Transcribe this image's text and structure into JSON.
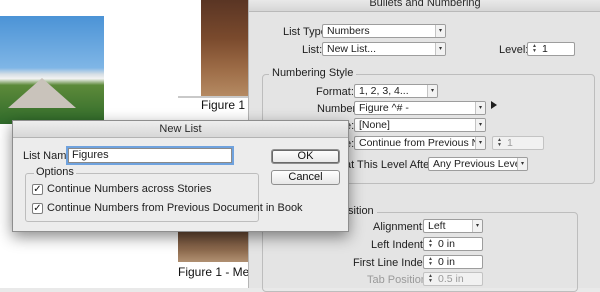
{
  "document": {
    "captions": [
      "Figure 1",
      "Figure 1 - Me"
    ]
  },
  "bullets_dialog": {
    "title": "Bullets and Numbering",
    "list_type_label": "List Type:",
    "list_type_value": "Numbers",
    "list_label": "List:",
    "list_value": "New List...",
    "level_label": "Level:",
    "level_value": "1",
    "numbering_style": {
      "title": "Numbering Style",
      "format_label": "Format:",
      "format_value": "1, 2, 3, 4...",
      "number_label": "Number:",
      "number_value": "Figure ^# -",
      "char_style_label_partial": "e:",
      "char_style_value": "[None]",
      "mode_label_partial": "e:",
      "mode_value": "Continue from Previous N...",
      "mode_start": "1",
      "restart_label_partial": "at This Level After:",
      "restart_value": "Any Previous Level"
    },
    "position": {
      "title_partial": "sition",
      "alignment_label": "Alignment:",
      "alignment_value": "Left",
      "left_indent_label": "Left Indent:",
      "left_indent_value": "0 in",
      "first_line_label": "First Line Indent:",
      "first_line_value": "0 in",
      "tab_position_label": "Tab Position:",
      "tab_position_value": "0.5 in"
    }
  },
  "new_list_dialog": {
    "title": "New List",
    "list_name_label": "List Name:",
    "list_name_value": "Figures",
    "options_label": "Options",
    "option_1": "Continue Numbers across Stories",
    "option_1_checked": true,
    "option_2": "Continue Numbers from Previous Document in Book",
    "option_2_checked": true,
    "check_mark": "✓",
    "ok_label": "OK",
    "cancel_label": "Cancel"
  },
  "glyphs": {
    "dropdown": "▾",
    "stepper_up": "▲",
    "stepper_down": "▼"
  },
  "colors": {
    "focus_ring": "#6fa2de",
    "dialog_bg": "#e4e4e4"
  }
}
